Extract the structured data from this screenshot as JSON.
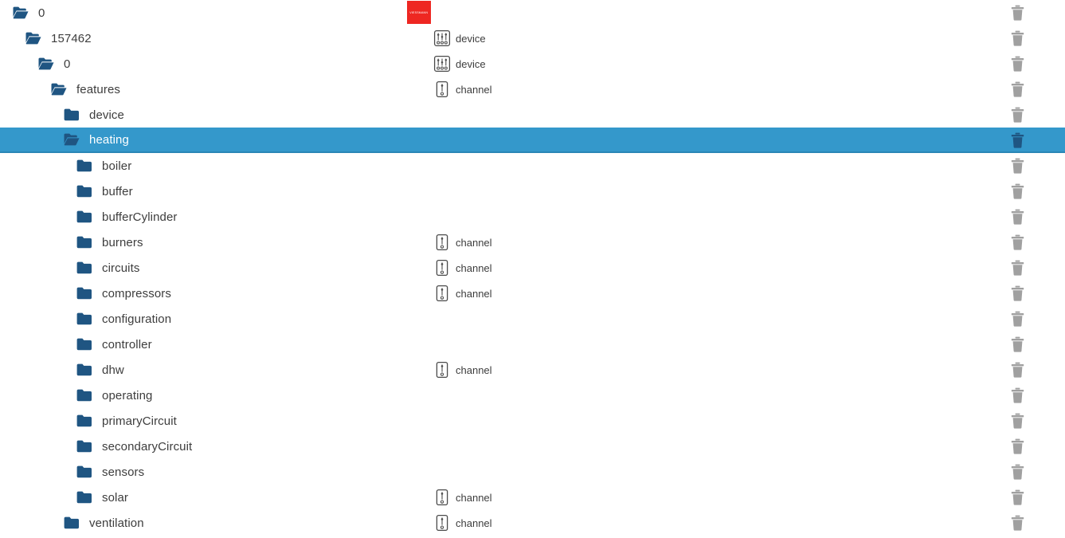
{
  "brand": {
    "logo_text": "VIESSMANN",
    "logo_color": "#ee2722"
  },
  "theme": {
    "folder_color": "#1f5582",
    "selected_row_bg": "#3498cb",
    "selected_row_border": "#2b86b6",
    "text_color": "#3d3d3d",
    "selected_text_color": "#ffffff",
    "trash_color": "#a0a0a0",
    "trash_selected_color": "#1f5582",
    "icon_stroke": "#4a4a4a"
  },
  "labels": {
    "device": "device",
    "channel": "channel"
  },
  "tree": {
    "rows": [
      {
        "label": "0",
        "depth": 0,
        "folder": "open",
        "type": "",
        "selected": false,
        "delete": true
      },
      {
        "label": "157462",
        "depth": 1,
        "folder": "open",
        "type": "device",
        "selected": false,
        "delete": true
      },
      {
        "label": "0",
        "depth": 2,
        "folder": "open",
        "type": "device",
        "selected": false,
        "delete": true
      },
      {
        "label": "features",
        "depth": 3,
        "folder": "open",
        "type": "channel",
        "selected": false,
        "delete": true
      },
      {
        "label": "device",
        "depth": 4,
        "folder": "closed",
        "type": "",
        "selected": false,
        "delete": true
      },
      {
        "label": "heating",
        "depth": 4,
        "folder": "open",
        "type": "",
        "selected": true,
        "delete": true
      },
      {
        "label": "boiler",
        "depth": 5,
        "folder": "closed",
        "type": "",
        "selected": false,
        "delete": true
      },
      {
        "label": "buffer",
        "depth": 5,
        "folder": "closed",
        "type": "",
        "selected": false,
        "delete": true
      },
      {
        "label": "bufferCylinder",
        "depth": 5,
        "folder": "closed",
        "type": "",
        "selected": false,
        "delete": true
      },
      {
        "label": "burners",
        "depth": 5,
        "folder": "closed",
        "type": "channel",
        "selected": false,
        "delete": true
      },
      {
        "label": "circuits",
        "depth": 5,
        "folder": "closed",
        "type": "channel",
        "selected": false,
        "delete": true
      },
      {
        "label": "compressors",
        "depth": 5,
        "folder": "closed",
        "type": "channel",
        "selected": false,
        "delete": true
      },
      {
        "label": "configuration",
        "depth": 5,
        "folder": "closed",
        "type": "",
        "selected": false,
        "delete": true
      },
      {
        "label": "controller",
        "depth": 5,
        "folder": "closed",
        "type": "",
        "selected": false,
        "delete": true
      },
      {
        "label": "dhw",
        "depth": 5,
        "folder": "closed",
        "type": "channel",
        "selected": false,
        "delete": true
      },
      {
        "label": "operating",
        "depth": 5,
        "folder": "closed",
        "type": "",
        "selected": false,
        "delete": true
      },
      {
        "label": "primaryCircuit",
        "depth": 5,
        "folder": "closed",
        "type": "",
        "selected": false,
        "delete": true
      },
      {
        "label": "secondaryCircuit",
        "depth": 5,
        "folder": "closed",
        "type": "",
        "selected": false,
        "delete": true
      },
      {
        "label": "sensors",
        "depth": 5,
        "folder": "closed",
        "type": "",
        "selected": false,
        "delete": true
      },
      {
        "label": "solar",
        "depth": 5,
        "folder": "closed",
        "type": "channel",
        "selected": false,
        "delete": true
      },
      {
        "label": "ventilation",
        "depth": 4,
        "folder": "closed",
        "type": "channel",
        "selected": false,
        "delete": true
      }
    ]
  }
}
